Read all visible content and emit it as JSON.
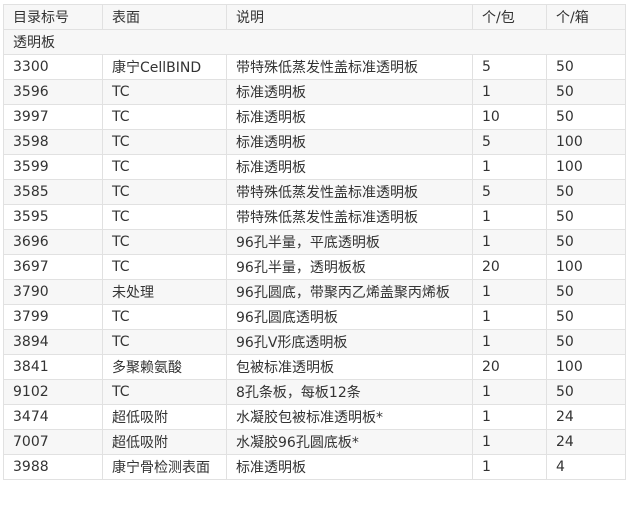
{
  "table": {
    "headers": [
      "目录标号",
      "表面",
      "说明",
      "个/包",
      "个/箱"
    ],
    "section_label": "透明板",
    "rows": [
      [
        "3300",
        "康宁CellBIND",
        "带特殊低蒸发性盖标准透明板",
        "5",
        "50"
      ],
      [
        "3596",
        "TC",
        "标准透明板",
        "1",
        "50"
      ],
      [
        "3997",
        "TC",
        "标准透明板",
        "10",
        "50"
      ],
      [
        "3598",
        "TC",
        "标准透明板",
        "5",
        "100"
      ],
      [
        "3599",
        "TC",
        "标准透明板",
        "1",
        "100"
      ],
      [
        "3585",
        "TC",
        "带特殊低蒸发性盖标准透明板",
        "5",
        "50"
      ],
      [
        "3595",
        "TC",
        "带特殊低蒸发性盖标准透明板",
        "1",
        "50"
      ],
      [
        "3696",
        "TC",
        "96孔半量，平底透明板",
        "1",
        "50"
      ],
      [
        "3697",
        "TC",
        "96孔半量，透明板板",
        "20",
        "100"
      ],
      [
        "3790",
        "未处理",
        "96孔圆底，带聚丙乙烯盖聚丙烯板",
        "1",
        "50"
      ],
      [
        "3799",
        "TC",
        "96孔圆底透明板",
        "1",
        "50"
      ],
      [
        "3894",
        "TC",
        "96孔V形底透明板",
        "1",
        "50"
      ],
      [
        "3841",
        "多聚赖氨酸",
        "包被标准透明板",
        "20",
        "100"
      ],
      [
        "9102",
        "TC",
        "8孔条板，每板12条",
        "1",
        "50"
      ],
      [
        "3474",
        "超低吸附",
        "水凝胶包被标准透明板*",
        "1",
        "24"
      ],
      [
        "7007",
        "超低吸附",
        "水凝胶96孔圆底板*",
        "1",
        "24"
      ],
      [
        "3988",
        "康宁骨检测表面",
        "标准透明板",
        "1",
        "4"
      ]
    ]
  }
}
